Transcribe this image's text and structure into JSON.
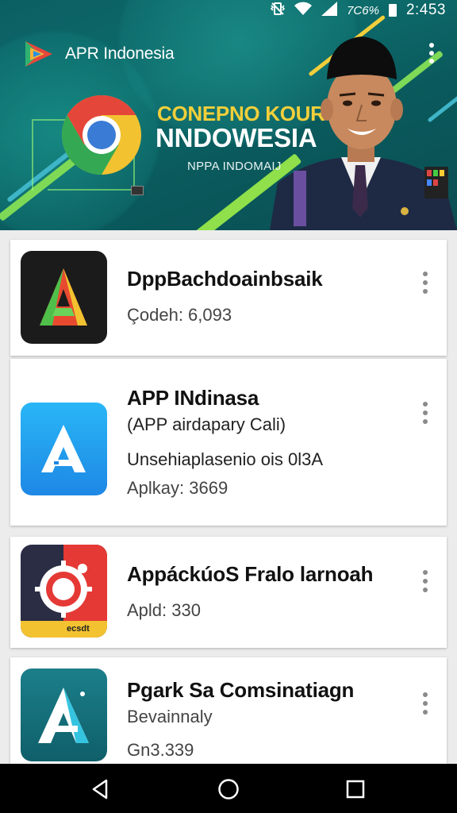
{
  "status_bar": {
    "icons": [
      "vibrate-icon",
      "wifi-icon",
      "signal-icon"
    ],
    "battery_text": "7C6%",
    "time": "2:453"
  },
  "app_bar": {
    "title": "APR Indonesia"
  },
  "banner": {
    "title_line_1": "CONEPNO KOUR",
    "title_line_2": "NNDOWESIA",
    "subtitle": "NPPA INDOMAIJ",
    "colors": {
      "background": "#0b5f63",
      "accent_yellow": "#f2cf3a",
      "accent_green": "#7ed957"
    }
  },
  "apps": [
    {
      "title": "DppBachdoainbsaik",
      "lines": [
        "Çodeh: 6,093"
      ],
      "icon": "red-green-a-icon"
    },
    {
      "title": "APP INdinasa",
      "lines": [
        "(APP airdapary Cali)",
        "Unsehiaplasenio ois 0l3A",
        "Aplkay: 3669"
      ],
      "icon": "blue-a-icon"
    },
    {
      "title": "AppáckúoS Fralo larnoah",
      "lines": [
        "Apld: 330"
      ],
      "icon": "red-target-icon",
      "icon_badge": "ecsdt"
    },
    {
      "title": "Pgark Sa Comsinatiagn",
      "lines": [
        "Bevainnaly",
        "Gn3.339"
      ],
      "icon": "teal-a-icon"
    }
  ],
  "navbar": {
    "buttons": [
      "back-icon",
      "home-icon",
      "recents-icon"
    ]
  }
}
